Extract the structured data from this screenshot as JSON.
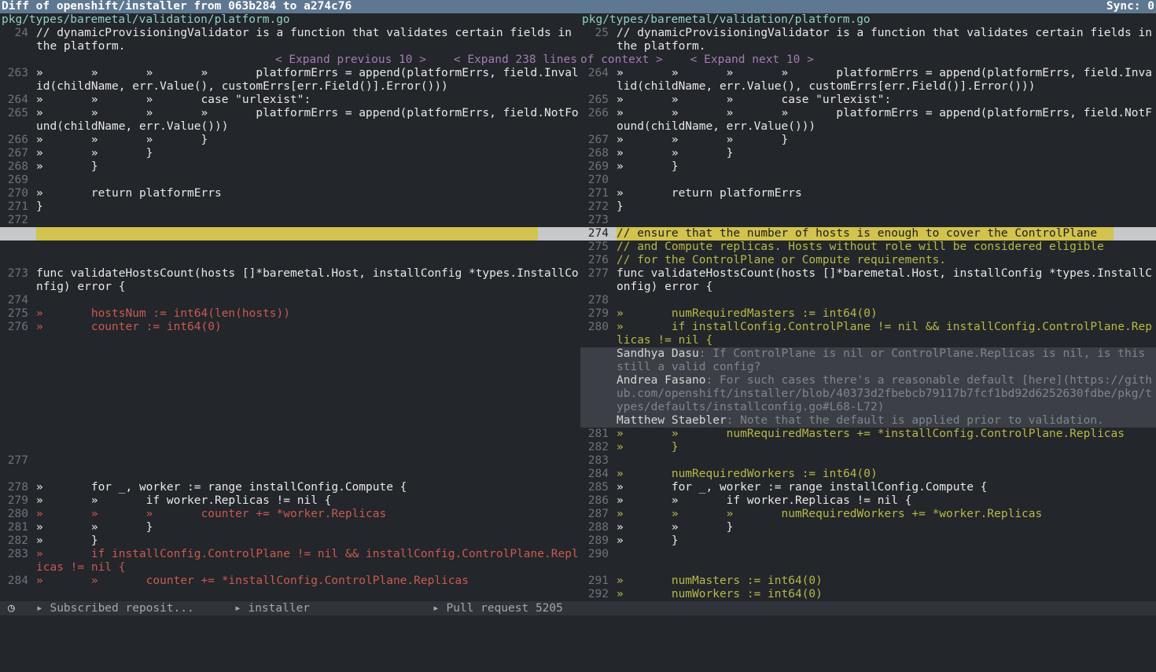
{
  "title": "Diff of openshift/installer from 063b284 to a274c76",
  "sync": "Sync: 0",
  "left_file": "pkg/types/baremetal/validation/platform.go",
  "right_file": "pkg/types/baremetal/validation/platform.go",
  "expand": {
    "left": "< Expand previous 10 >    < Expand 238 lines",
    "right": "of context >    < Expand next 10 >"
  },
  "left_rows": [
    {
      "n": "24",
      "t": "// dynamicProvisioningValidator is a function that validates certain fields in the platform.",
      "k": ""
    },
    {
      "n": "",
      "t": "",
      "k": "expand"
    },
    {
      "n": "263",
      "t": "»       »       »       »       platformErrs = append(platformErrs, field.Invalid(childName, err.Value(), customErrs[err.Field()].Error()))",
      "k": ""
    },
    {
      "n": "264",
      "t": "»       »       »       case \"urlexist\":",
      "k": ""
    },
    {
      "n": "265",
      "t": "»       »       »       »       platformErrs = append(platformErrs, field.NotFound(childName, err.Value()))",
      "k": ""
    },
    {
      "n": "266",
      "t": "»       »       »       }",
      "k": ""
    },
    {
      "n": "267",
      "t": "»       »       }",
      "k": ""
    },
    {
      "n": "268",
      "t": "»       }",
      "k": ""
    },
    {
      "n": "269",
      "t": "",
      "k": ""
    },
    {
      "n": "270",
      "t": "»       return platformErrs",
      "k": ""
    },
    {
      "n": "271",
      "t": "}",
      "k": ""
    },
    {
      "n": "272",
      "t": "",
      "k": ""
    },
    {
      "n": "",
      "t": "",
      "k": "hl"
    },
    {
      "n": "",
      "t": "",
      "k": "blank"
    },
    {
      "n": "",
      "t": "",
      "k": "blank"
    },
    {
      "n": "273",
      "t": "func validateHostsCount(hosts []*baremetal.Host, installConfig *types.InstallConfig) error {",
      "k": ""
    },
    {
      "n": "274",
      "t": "",
      "k": ""
    },
    {
      "n": "275",
      "t": "»       hostsNum := int64(len(hosts))",
      "k": "del"
    },
    {
      "n": "276",
      "t": "»       counter := int64(0)",
      "k": "del"
    },
    {
      "n": "",
      "t": "",
      "k": "blank"
    },
    {
      "n": "",
      "t": "",
      "k": "blank"
    },
    {
      "n": "",
      "t": "",
      "k": "blank"
    },
    {
      "n": "",
      "t": "",
      "k": "blank"
    },
    {
      "n": "",
      "t": "",
      "k": "blank"
    },
    {
      "n": "",
      "t": "",
      "k": "blank"
    },
    {
      "n": "",
      "t": "",
      "k": "blank"
    },
    {
      "n": "",
      "t": "",
      "k": "blank"
    },
    {
      "n": "",
      "t": "",
      "k": "blank"
    },
    {
      "n": "277",
      "t": "",
      "k": ""
    },
    {
      "n": "",
      "t": "",
      "k": "blank"
    },
    {
      "n": "278",
      "t": "»       for _, worker := range installConfig.Compute {",
      "k": ""
    },
    {
      "n": "279",
      "t": "»       »       if worker.Replicas != nil {",
      "k": ""
    },
    {
      "n": "280",
      "t": "»       »       »       counter += *worker.Replicas",
      "k": "del"
    },
    {
      "n": "281",
      "t": "»       »       }",
      "k": ""
    },
    {
      "n": "282",
      "t": "»       }",
      "k": ""
    },
    {
      "n": "283",
      "t": "»       if installConfig.ControlPlane != nil && installConfig.ControlPlane.Replicas != nil {",
      "k": "del"
    },
    {
      "n": "284",
      "t": "»       »       counter += *installConfig.ControlPlane.Replicas",
      "k": "del"
    }
  ],
  "right_rows": [
    {
      "n": "25",
      "t": "// dynamicProvisioningValidator is a function that validates certain fields in the platform.",
      "k": ""
    },
    {
      "n": "",
      "t": "",
      "k": "expand"
    },
    {
      "n": "264",
      "t": "»       »       »       »       platformErrs = append(platformErrs, field.Invalid(childName, err.Value(), customErrs[err.Field()].Error()))",
      "k": ""
    },
    {
      "n": "265",
      "t": "»       »       »       case \"urlexist\":",
      "k": ""
    },
    {
      "n": "266",
      "t": "»       »       »       »       platformErrs = append(platformErrs, field.NotFound(childName, err.Value()))",
      "k": ""
    },
    {
      "n": "267",
      "t": "»       »       »       }",
      "k": ""
    },
    {
      "n": "268",
      "t": "»       »       }",
      "k": ""
    },
    {
      "n": "269",
      "t": "»       }",
      "k": ""
    },
    {
      "n": "270",
      "t": "",
      "k": ""
    },
    {
      "n": "271",
      "t": "»       return platformErrs",
      "k": ""
    },
    {
      "n": "272",
      "t": "}",
      "k": ""
    },
    {
      "n": "273",
      "t": "",
      "k": ""
    },
    {
      "n": "274",
      "t": "// ensure that the number of hosts is enough to cover the ControlPlane",
      "k": "hl"
    },
    {
      "n": "275",
      "t": "// and Compute replicas. Hosts without role will be considered eligible",
      "k": "cmt"
    },
    {
      "n": "276",
      "t": "// for the ControlPlane or Compute requirements.",
      "k": "cmt"
    },
    {
      "n": "277",
      "t": "func validateHostsCount(hosts []*baremetal.Host, installConfig *types.InstallConfig) error {",
      "k": ""
    },
    {
      "n": "278",
      "t": "",
      "k": ""
    },
    {
      "n": "279",
      "t": "»       numRequiredMasters := int64(0)",
      "k": "add"
    },
    {
      "n": "280",
      "t": "»       if installConfig.ControlPlane != nil && installConfig.ControlPlane.Replicas != nil {",
      "k": "add"
    },
    {
      "n": "",
      "t": "",
      "k": "note",
      "a": "Sandhya Dasu",
      "m": ": If ControlPlane is nil or ControlPlane.Replicas is nil, is this still a valid config?"
    },
    {
      "n": "",
      "t": "",
      "k": "note",
      "a": "Andrea Fasano",
      "m": ": For such cases there's a reasonable default [here](https://github.com/openshift/installer/blob/40373d2fbebcb79117b7fcf1bd92d6252630fdbe/pkg/types/defaults/installconfig.go#L68-L72)"
    },
    {
      "n": "",
      "t": "",
      "k": "note",
      "a": "Matthew Staebler",
      "m": ": Note that the default is applied prior to validation."
    },
    {
      "n": "281",
      "t": "»       »       numRequiredMasters += *installConfig.ControlPlane.Replicas",
      "k": "add"
    },
    {
      "n": "282",
      "t": "»       }",
      "k": "add"
    },
    {
      "n": "283",
      "t": "",
      "k": ""
    },
    {
      "n": "284",
      "t": "»       numRequiredWorkers := int64(0)",
      "k": "add"
    },
    {
      "n": "285",
      "t": "»       for _, worker := range installConfig.Compute {",
      "k": ""
    },
    {
      "n": "286",
      "t": "»       »       if worker.Replicas != nil {",
      "k": ""
    },
    {
      "n": "287",
      "t": "»       »       »       numRequiredWorkers += *worker.Replicas",
      "k": "add"
    },
    {
      "n": "288",
      "t": "»       »       }",
      "k": ""
    },
    {
      "n": "289",
      "t": "»       }",
      "k": ""
    },
    {
      "n": "290",
      "t": "",
      "k": ""
    },
    {
      "n": "",
      "t": "",
      "k": "blank"
    },
    {
      "n": "291",
      "t": "»       numMasters := int64(0)",
      "k": "add"
    },
    {
      "n": "292",
      "t": "»       numWorkers := int64(0)",
      "k": "add"
    }
  ],
  "status": {
    "clock_icon": "clock-icon",
    "crumbs": [
      "▸ Subscribed reposit...",
      "▸ installer",
      "▸ Pull request 5205"
    ]
  }
}
